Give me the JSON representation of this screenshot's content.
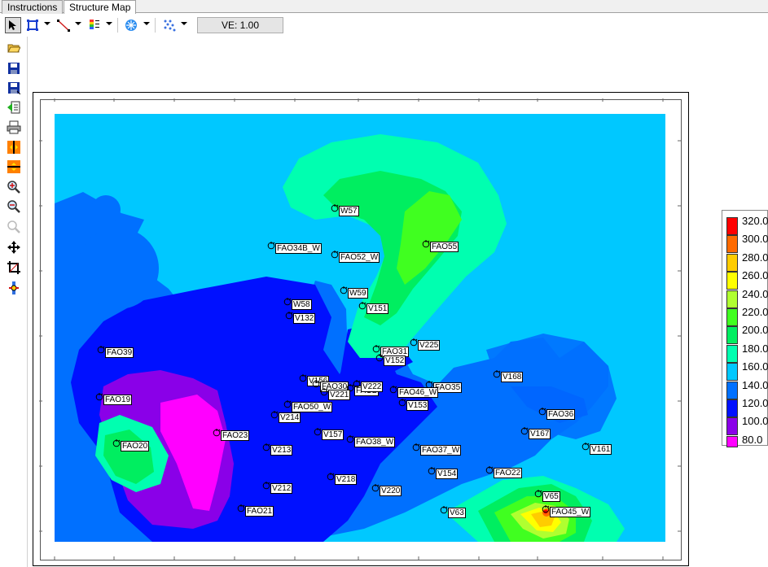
{
  "tabs": [
    {
      "label": "Instructions"
    },
    {
      "label": "Structure Map"
    }
  ],
  "toolbar": {
    "ve_label": "VE: 1.00",
    "tools": [
      "select-arrow-icon",
      "zoom-region-icon",
      "draw-line-icon",
      "color-bar-icon",
      "contour-icon",
      "wells-points-icon"
    ]
  },
  "left_tools": [
    "open-folder-icon",
    "save-icon",
    "save-as-icon",
    "export-icon",
    "print-icon",
    "split-horizontal-icon",
    "split-vertical-icon",
    "zoom-in-icon",
    "zoom-out-icon",
    "zoom-reset-icon",
    "pan-icon",
    "crop-icon",
    "info-icon"
  ],
  "legend": {
    "levels": [
      "320.0",
      "300.0",
      "280.0",
      "260.0",
      "240.0",
      "220.0",
      "200.0",
      "180.0",
      "160.0",
      "140.0",
      "120.0",
      "100.0",
      "80.0"
    ],
    "colors": [
      "#ff0000",
      "#ff6a00",
      "#ffcc00",
      "#ffff00",
      "#b0ff30",
      "#40ff20",
      "#00ee60",
      "#00ffb0",
      "#00c8ff",
      "#0070ff",
      "#0010ff",
      "#8a00e8",
      "#ff00ff"
    ]
  },
  "wells": [
    {
      "name": "W57"
    },
    {
      "name": "FAO34B_W"
    },
    {
      "name": "FAO52_W"
    },
    {
      "name": "FAO55"
    },
    {
      "name": "W59"
    },
    {
      "name": "W58"
    },
    {
      "name": "V151"
    },
    {
      "name": "V132"
    },
    {
      "name": "FAO39"
    },
    {
      "name": "V225"
    },
    {
      "name": "FAO31"
    },
    {
      "name": "V152"
    },
    {
      "name": "V168"
    },
    {
      "name": "V156"
    },
    {
      "name": "FAO30"
    },
    {
      "name": "FAO2"
    },
    {
      "name": "V222"
    },
    {
      "name": "V221"
    },
    {
      "name": "FAO35"
    },
    {
      "name": "FAO46_W"
    },
    {
      "name": "FAO19"
    },
    {
      "name": "V153"
    },
    {
      "name": "FAO50_W"
    },
    {
      "name": "V214"
    },
    {
      "name": "FAO36"
    },
    {
      "name": "FAO23"
    },
    {
      "name": "V157"
    },
    {
      "name": "FAO38_W"
    },
    {
      "name": "V167"
    },
    {
      "name": "FAO20"
    },
    {
      "name": "V213"
    },
    {
      "name": "FAO37_W"
    },
    {
      "name": "V161"
    },
    {
      "name": "V154"
    },
    {
      "name": "FAO22"
    },
    {
      "name": "V218"
    },
    {
      "name": "V212"
    },
    {
      "name": "V220"
    },
    {
      "name": "V65"
    },
    {
      "name": "FAO21"
    },
    {
      "name": "V63"
    },
    {
      "name": "FAO45_W"
    }
  ]
}
